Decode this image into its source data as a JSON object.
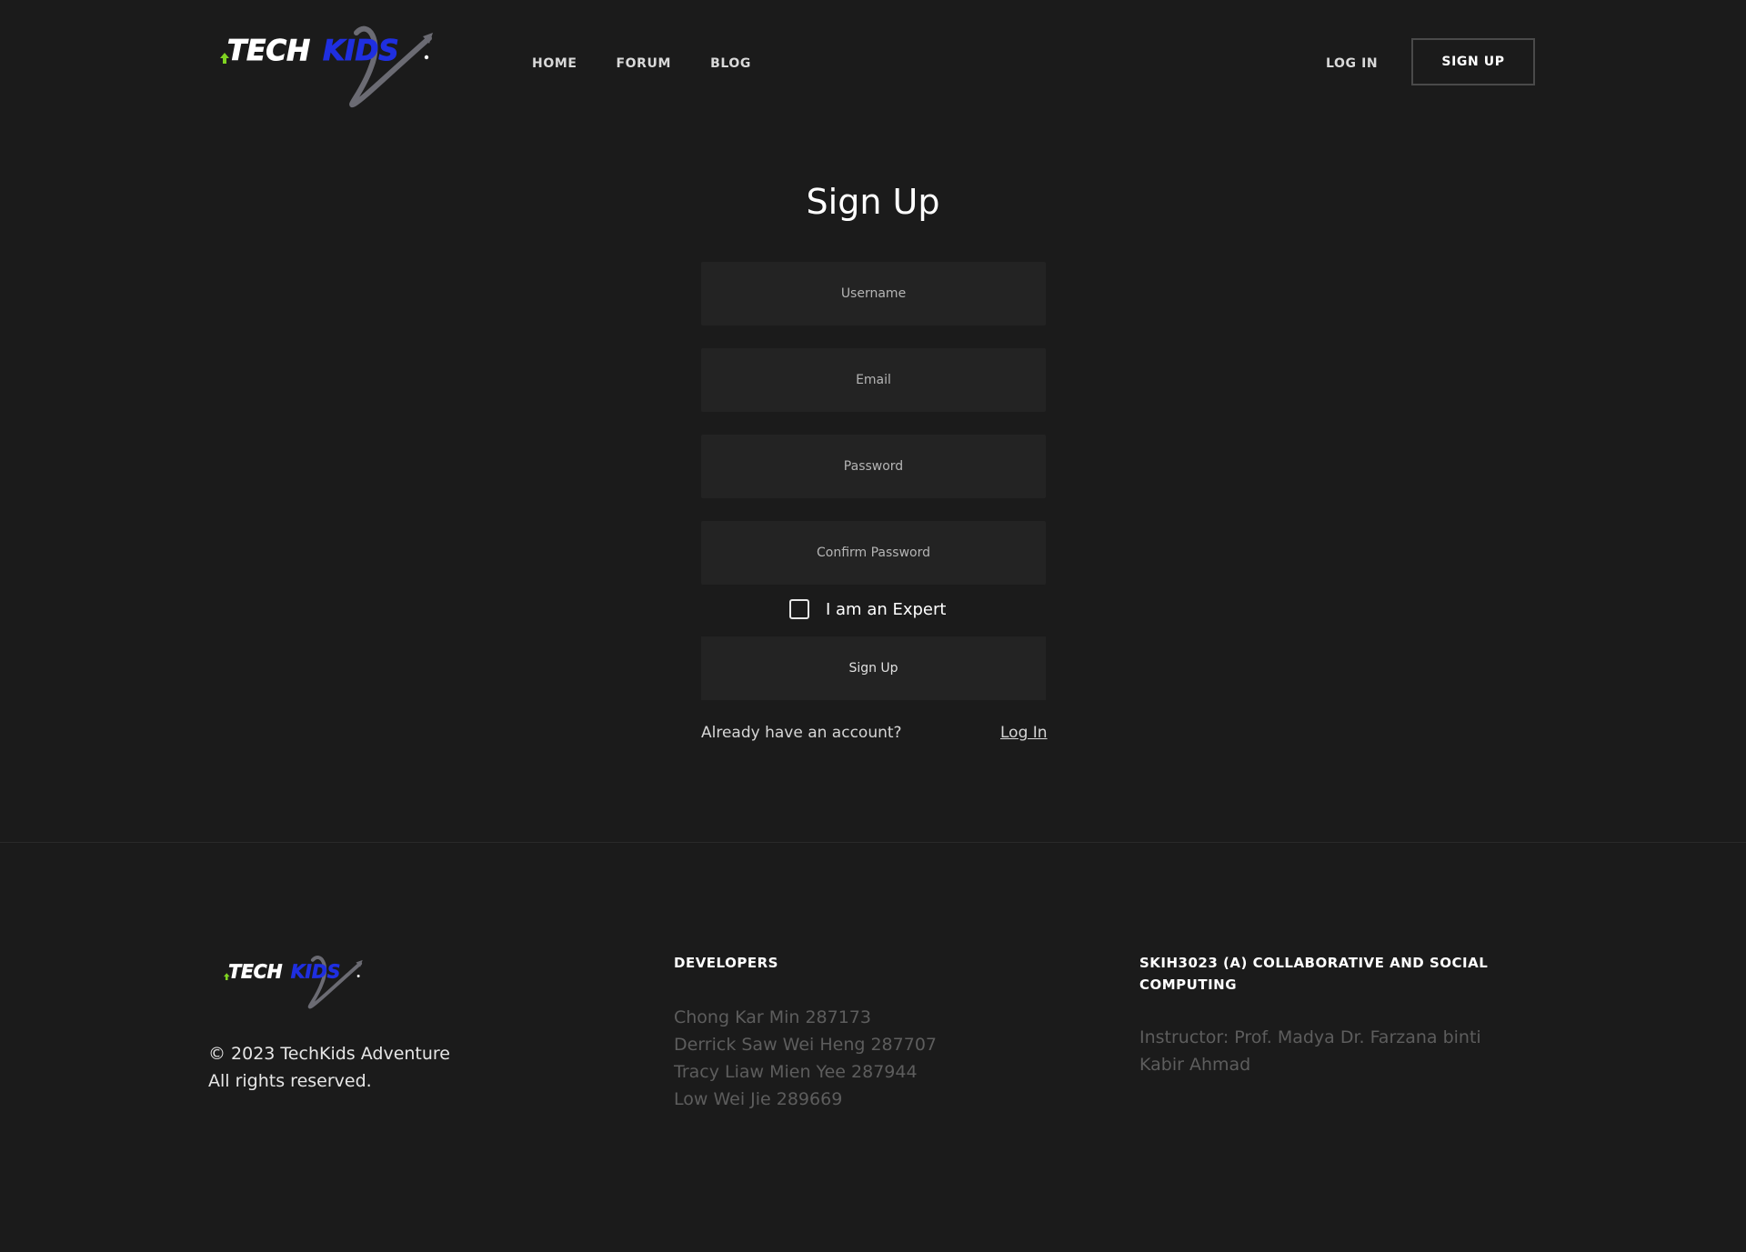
{
  "brand": {
    "logo_tech": "TECH",
    "logo_kids": "KIDS",
    "tech_color": "#ffffff",
    "kids_color": "#1f2fe0",
    "arrow_color": "#7fd321",
    "swoosh_color": "#6b6b73"
  },
  "nav": {
    "items": [
      {
        "label": "HOME"
      },
      {
        "label": "FORUM"
      },
      {
        "label": "BLOG"
      }
    ],
    "login_label": "LOG IN",
    "signup_label": "SIGN UP"
  },
  "form": {
    "title": "Sign Up",
    "username_placeholder": "Username",
    "email_placeholder": "Email",
    "password_placeholder": "Password",
    "confirm_placeholder": "Confirm Password",
    "expert_label": "I am an Expert",
    "expert_checked": false,
    "submit_label": "Sign Up",
    "already_text": "Already have an account?",
    "login_link": "Log In"
  },
  "footer": {
    "copyright_line1": "© 2023 TechKids Adventure",
    "copyright_line2": "All rights reserved.",
    "developers_heading": "DEVELOPERS",
    "developers": [
      "Chong Kar Min 287173",
      "Derrick Saw Wei Heng 287707",
      "Tracy Liaw Mien Yee 287944",
      "Low Wei Jie 289669"
    ],
    "course_heading": "SKIH3023 (A) COLLABORATIVE AND SOCIAL COMPUTING",
    "instructor": "Instructor: Prof. Madya Dr. Farzana binti Kabir Ahmad"
  }
}
